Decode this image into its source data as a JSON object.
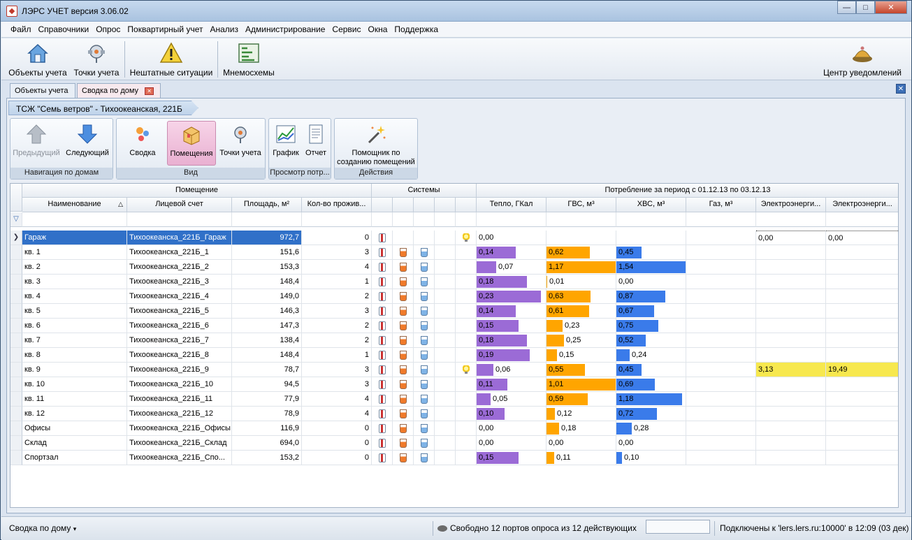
{
  "window": {
    "title": "ЛЭРС УЧЕТ версия 3.06.02",
    "min": "—",
    "max": "□",
    "close": "✕"
  },
  "menu": [
    "Файл",
    "Справочники",
    "Опрос",
    "Поквартирный учет",
    "Анализ",
    "Администрирование",
    "Сервис",
    "Окна",
    "Поддержка"
  ],
  "toolbar": {
    "objects": "Объекты учета",
    "points": "Точки учета",
    "incidents": "Нештатные ситуации",
    "mnemo": "Мнемосхемы",
    "notifications": "Центр уведомлений"
  },
  "tabs": [
    {
      "label": "Объекты учета"
    },
    {
      "label": "Сводка по дому",
      "close": "✕"
    }
  ],
  "panel_close": "✕",
  "breadcrumb": "ТСЖ \"Семь ветров\" - Тихоокеанская, 221Б",
  "ribbon": {
    "nav": {
      "prev": "Предыдущий",
      "next": "Следующий",
      "caption": "Навигация по домам"
    },
    "view": {
      "summary": "Сводка",
      "rooms": "Помещения",
      "points": "Точки учета",
      "caption": "Вид"
    },
    "consumption": {
      "chart": "График",
      "report": "Отчет",
      "caption": "Просмотр потр..."
    },
    "actions": {
      "wizard": "Помощник по созданию помещений",
      "caption": "Действия"
    }
  },
  "grid": {
    "group_headers": {
      "room": "Помещение",
      "systems": "Системы",
      "consumption": "Потребление за период с 01.12.13 по 03.12.13"
    },
    "columns": {
      "name": "Наименование",
      "sort_indicator": "△",
      "account": "Лицевой счет",
      "area": "Площадь, м²",
      "residents": "Кол-во прожив...",
      "heat": "Тепло, ГКал",
      "hws": "ГВС, м³",
      "cws": "ХВС, м³",
      "gas": "Газ, м³",
      "elec1": "Электроэнерги...",
      "elec2": "Электроэнерги..."
    },
    "filter_icon": "▽",
    "selected_marker": "❯",
    "colors": {
      "heat": "#9b6bd6",
      "hws": "#ffa500",
      "cws": "#3a7bea",
      "elec": "#f7e84e",
      "selection": "#3070c8"
    },
    "rows": [
      {
        "name": "Гараж",
        "account": "Тихоокеанска_221Б_Гараж",
        "area": "972,7",
        "residents": "0",
        "hws_icon": false,
        "cws_icon": false,
        "bulb": true,
        "heat": "0,00",
        "hws": "",
        "cws": "",
        "gas": "",
        "elec1": "0,00",
        "elec2": "0,00",
        "heat_v": 0,
        "hws_v": 0,
        "cws_v": 0,
        "selected": true
      },
      {
        "name": "кв. 1",
        "account": "Тихоокеанска_221Б_1",
        "area": "151,6",
        "residents": "3",
        "hws_icon": true,
        "cws_icon": true,
        "bulb": false,
        "heat": "0,14",
        "hws": "0,62",
        "cws": "0,45",
        "gas": "",
        "elec1": "",
        "elec2": "",
        "heat_v": 0.14,
        "hws_v": 0.62,
        "cws_v": 0.45
      },
      {
        "name": "кв. 2",
        "account": "Тихоокеанска_221Б_2",
        "area": "153,3",
        "residents": "4",
        "hws_icon": true,
        "cws_icon": true,
        "bulb": false,
        "heat": "0,07",
        "hws": "1,17",
        "cws": "1,54",
        "gas": "",
        "elec1": "",
        "elec2": "",
        "heat_v": 0.07,
        "hws_v": 1.17,
        "cws_v": 1.54
      },
      {
        "name": "кв. 3",
        "account": "Тихоокеанска_221Б_3",
        "area": "148,4",
        "residents": "1",
        "hws_icon": true,
        "cws_icon": true,
        "bulb": false,
        "heat": "0,18",
        "hws": "0,01",
        "cws": "0,00",
        "gas": "",
        "elec1": "",
        "elec2": "",
        "heat_v": 0.18,
        "hws_v": 0.01,
        "cws_v": 0
      },
      {
        "name": "кв. 4",
        "account": "Тихоокеанска_221Б_4",
        "area": "149,0",
        "residents": "2",
        "hws_icon": true,
        "cws_icon": true,
        "bulb": false,
        "heat": "0,23",
        "hws": "0,63",
        "cws": "0,87",
        "gas": "",
        "elec1": "",
        "elec2": "",
        "heat_v": 0.23,
        "hws_v": 0.63,
        "cws_v": 0.87
      },
      {
        "name": "кв. 5",
        "account": "Тихоокеанска_221Б_5",
        "area": "146,3",
        "residents": "3",
        "hws_icon": true,
        "cws_icon": true,
        "bulb": false,
        "heat": "0,14",
        "hws": "0,61",
        "cws": "0,67",
        "gas": "",
        "elec1": "",
        "elec2": "",
        "heat_v": 0.14,
        "hws_v": 0.61,
        "cws_v": 0.67
      },
      {
        "name": "кв. 6",
        "account": "Тихоокеанска_221Б_6",
        "area": "147,3",
        "residents": "2",
        "hws_icon": true,
        "cws_icon": true,
        "bulb": false,
        "heat": "0,15",
        "hws": "0,23",
        "cws": "0,75",
        "gas": "",
        "elec1": "",
        "elec2": "",
        "heat_v": 0.15,
        "hws_v": 0.23,
        "cws_v": 0.75
      },
      {
        "name": "кв. 7",
        "account": "Тихоокеанска_221Б_7",
        "area": "138,4",
        "residents": "2",
        "hws_icon": true,
        "cws_icon": true,
        "bulb": false,
        "heat": "0,18",
        "hws": "0,25",
        "cws": "0,52",
        "gas": "",
        "elec1": "",
        "elec2": "",
        "heat_v": 0.18,
        "hws_v": 0.25,
        "cws_v": 0.52
      },
      {
        "name": "кв. 8",
        "account": "Тихоокеанска_221Б_8",
        "area": "148,4",
        "residents": "1",
        "hws_icon": true,
        "cws_icon": true,
        "bulb": false,
        "heat": "0,19",
        "hws": "0,15",
        "cws": "0,24",
        "gas": "",
        "elec1": "",
        "elec2": "",
        "heat_v": 0.19,
        "hws_v": 0.15,
        "cws_v": 0.24
      },
      {
        "name": "кв. 9",
        "account": "Тихоокеанска_221Б_9",
        "area": "78,7",
        "residents": "3",
        "hws_icon": true,
        "cws_icon": true,
        "bulb": true,
        "heat": "0,06",
        "hws": "0,55",
        "cws": "0,45",
        "gas": "",
        "elec1": "3,13",
        "elec2": "19,49",
        "heat_v": 0.06,
        "hws_v": 0.55,
        "cws_v": 0.45,
        "elec_v": true
      },
      {
        "name": "кв. 10",
        "account": "Тихоокеанска_221Б_10",
        "area": "94,5",
        "residents": "3",
        "hws_icon": true,
        "cws_icon": true,
        "bulb": false,
        "heat": "0,11",
        "hws": "1,01",
        "cws": "0,69",
        "gas": "",
        "elec1": "",
        "elec2": "",
        "heat_v": 0.11,
        "hws_v": 1.01,
        "cws_v": 0.69
      },
      {
        "name": "кв. 11",
        "account": "Тихоокеанска_221Б_11",
        "area": "77,9",
        "residents": "4",
        "hws_icon": true,
        "cws_icon": true,
        "bulb": false,
        "heat": "0,05",
        "hws": "0,59",
        "cws": "1,18",
        "gas": "",
        "elec1": "",
        "elec2": "",
        "heat_v": 0.05,
        "hws_v": 0.59,
        "cws_v": 1.18
      },
      {
        "name": "кв. 12",
        "account": "Тихоокеанска_221Б_12",
        "area": "78,9",
        "residents": "4",
        "hws_icon": true,
        "cws_icon": true,
        "bulb": false,
        "heat": "0,10",
        "hws": "0,12",
        "cws": "0,72",
        "gas": "",
        "elec1": "",
        "elec2": "",
        "heat_v": 0.1,
        "hws_v": 0.12,
        "cws_v": 0.72
      },
      {
        "name": "Офисы",
        "account": "Тихоокеанска_221Б_Офисы",
        "area": "116,9",
        "residents": "0",
        "hws_icon": true,
        "cws_icon": true,
        "bulb": false,
        "heat": "0,00",
        "hws": "0,18",
        "cws": "0,28",
        "gas": "",
        "elec1": "",
        "elec2": "",
        "heat_v": 0,
        "hws_v": 0.18,
        "cws_v": 0.28
      },
      {
        "name": "Склад",
        "account": "Тихоокеанска_221Б_Склад",
        "area": "694,0",
        "residents": "0",
        "hws_icon": true,
        "cws_icon": true,
        "bulb": false,
        "heat": "0,00",
        "hws": "0,00",
        "cws": "0,00",
        "gas": "",
        "elec1": "",
        "elec2": "",
        "heat_v": 0,
        "hws_v": 0,
        "cws_v": 0
      },
      {
        "name": "Спортзал",
        "account": "Тихоокеанска_221Б_Спо...",
        "area": "153,2",
        "residents": "0",
        "hws_icon": true,
        "cws_icon": true,
        "bulb": false,
        "heat": "0,15",
        "hws": "0,11",
        "cws": "0,10",
        "gas": "",
        "elec1": "",
        "elec2": "",
        "heat_v": 0.15,
        "hws_v": 0.11,
        "cws_v": 0.1
      }
    ]
  },
  "status": {
    "left": "Сводка по дому",
    "left_arrow": "▾",
    "ports": "Свободно 12 портов опроса из 12 действующих",
    "connection": "Подключены к 'lers.lers.ru:10000' в 12:09 (03 дек)"
  }
}
